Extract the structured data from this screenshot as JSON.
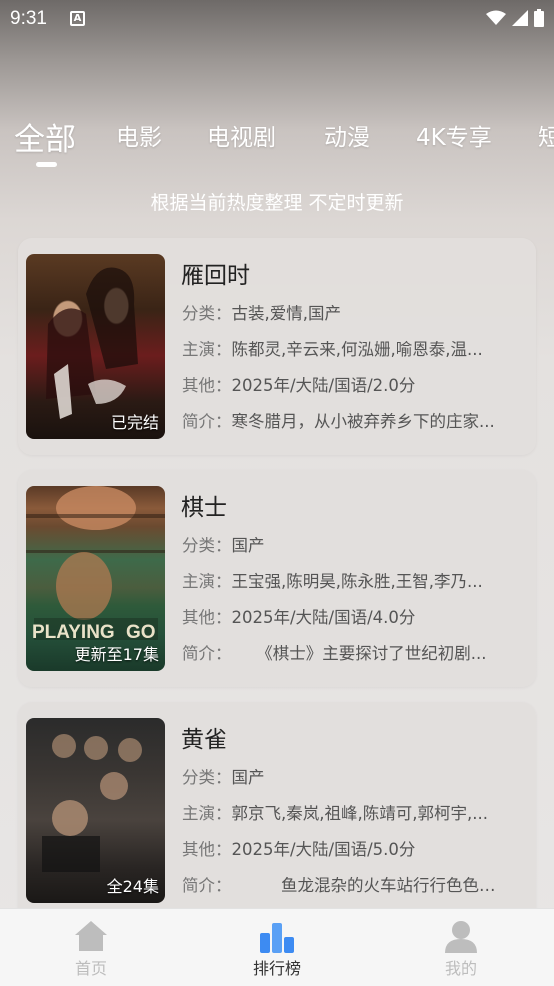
{
  "status_bar": {
    "time": "9:31",
    "notif": "A"
  },
  "tabs": [
    {
      "label": "全部",
      "active": true
    },
    {
      "label": "电影"
    },
    {
      "label": "电视剧"
    },
    {
      "label": "动漫"
    },
    {
      "label": "4K专享"
    },
    {
      "label": "短"
    }
  ],
  "subtitle": "根据当前热度整理 不定时更新",
  "items": [
    {
      "title": "雁回时",
      "badge": "已完结",
      "category_label": "分类：",
      "category": "古装,爱情,国产",
      "cast_label": "主演：",
      "cast": "陈都灵,辛云来,何泓姗,喻恩泰,温...",
      "other_label": "其他：",
      "other": "2025年/大陆/国语/2.0分",
      "intro_label": "简介：",
      "intro": "寒冬腊月，从小被弃养乡下的庄家..."
    },
    {
      "title": "棋士",
      "badge": "更新至17集",
      "category_label": "分类：",
      "category": "国产",
      "cast_label": "主演：",
      "cast": "王宝强,陈明昊,陈永胜,王智,李乃...",
      "other_label": "其他：",
      "other": "2025年/大陆/国语/4.0分",
      "intro_label": "简介：",
      "intro": "　　《棋士》主要探讨了世纪初剧..."
    },
    {
      "title": "黄雀",
      "badge": "全24集",
      "category_label": "分类：",
      "category": "国产",
      "cast_label": "主演：",
      "cast": "郭京飞,秦岚,祖峰,陈靖可,郭柯宇,...",
      "other_label": "其他：",
      "other": "2025年/大陆/国语/5.0分",
      "intro_label": "简介：",
      "intro": "　　　鱼龙混杂的火车站行行色色的..."
    }
  ],
  "nav": [
    {
      "label": "首页",
      "icon": "home-icon"
    },
    {
      "label": "排行榜",
      "icon": "ranking-icon",
      "active": true
    },
    {
      "label": "我的",
      "icon": "profile-icon"
    }
  ],
  "colors": {
    "active_nav_icon": "#3d8bf2",
    "inactive_nav": "#bdbdbd"
  }
}
